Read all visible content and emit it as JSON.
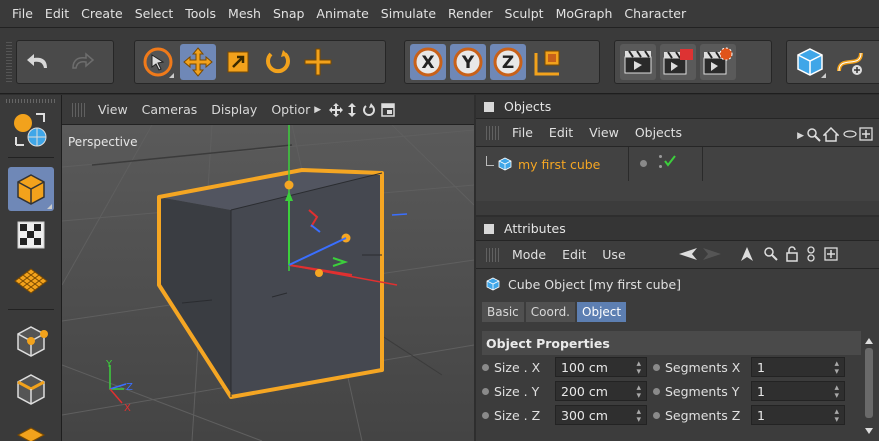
{
  "menu": [
    "File",
    "Edit",
    "Create",
    "Select",
    "Tools",
    "Mesh",
    "Snap",
    "Animate",
    "Simulate",
    "Render",
    "Sculpt",
    "MoGraph",
    "Character"
  ],
  "toolbar": {
    "undo": "undo-icon",
    "redo": "redo-icon",
    "select": "live-selection-icon",
    "move": "move-icon",
    "scale": "scale-icon",
    "rotate": "rotate-icon",
    "last_tool": "last-tool-icon",
    "axis_x": "X",
    "axis_y": "Y",
    "axis_z": "Z",
    "coord_system": "coordinate-system-icon",
    "render_view": "render-view-icon",
    "render_picture_viewer": "render-to-picture-viewer-icon",
    "render_settings": "render-settings-icon",
    "cube": "cube-icon",
    "spline": "spline-icon"
  },
  "viewport": {
    "menu": [
      "View",
      "Cameras",
      "Display",
      "Optior"
    ],
    "label": "Perspective",
    "axis_y": "Y",
    "axis_z": "Z",
    "axis_x": "X"
  },
  "objects": {
    "title": "Objects",
    "menu": [
      "File",
      "Edit",
      "View",
      "Objects"
    ],
    "items": [
      {
        "name": "my first cube"
      }
    ]
  },
  "attributes": {
    "title": "Attributes",
    "menu": [
      "Mode",
      "Edit",
      "Use"
    ],
    "object_title": "Cube Object [my first cube]",
    "tabs": [
      "Basic",
      "Coord.",
      "Object"
    ],
    "active_tab": "Object",
    "section": "Object Properties",
    "rows": [
      {
        "label": "Size . X",
        "value": "100 cm",
        "seg_label": "Segments X",
        "seg_value": "1"
      },
      {
        "label": "Size . Y",
        "value": "200 cm",
        "seg_label": "Segments Y",
        "seg_value": "1"
      },
      {
        "label": "Size . Z",
        "value": "300 cm",
        "seg_label": "Segments Z",
        "seg_value": "1"
      }
    ]
  },
  "colors": {
    "accent_blue": "#6f88b7",
    "selection_orange": "#f5a623",
    "axis_red": "#e03030",
    "axis_green": "#3ccf3c",
    "axis_blue": "#3a6fff"
  }
}
